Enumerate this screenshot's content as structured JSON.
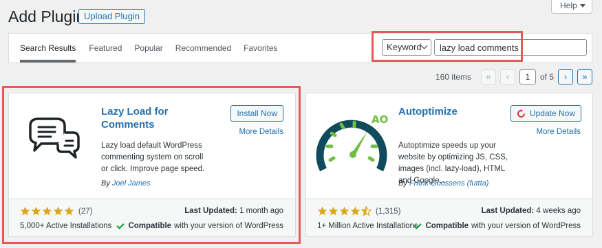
{
  "header": {
    "title": "Add Plugins",
    "upload_label": "Upload Plugin",
    "help_label": "Help"
  },
  "tabs": [
    {
      "label": "Search Results",
      "active": true
    },
    {
      "label": "Featured"
    },
    {
      "label": "Popular"
    },
    {
      "label": "Recommended"
    },
    {
      "label": "Favorites"
    }
  ],
  "search": {
    "type_selected": "Keyword",
    "query": "lazy load comments"
  },
  "pagination": {
    "items": "160 items",
    "first": "«",
    "prev": "‹",
    "current_page": "1",
    "total_pages": "of 5",
    "next": "›",
    "last": "»"
  },
  "plugins": [
    {
      "name": "Lazy Load for Comments",
      "action": "Install Now",
      "more": "More Details",
      "description": "Lazy load default WordPress commenting system on scroll or click. Improve page speed.",
      "by": "By",
      "author": "Joel James",
      "rating": 5,
      "rating_count": "(27)",
      "installs": "5,000+ Active Installations",
      "updated_label": "Last Updated:",
      "updated_value": "1 month ago",
      "compat_bold": "Compatible",
      "compat_rest": "with your version of WordPress",
      "icon": "speech-bubbles-icon"
    },
    {
      "name": "Autoptimize",
      "action": "Update Now",
      "more": "More Details",
      "description": "Autoptimize speeds up your website by optimizing JS, CSS, images (incl. lazy-load), HTML and Google…",
      "by": "By",
      "author": "Frank Goossens (futtta)",
      "rating": 4.5,
      "rating_count": "(1,315)",
      "installs": "1+ Million Active Installations",
      "updated_label": "Last Updated:",
      "updated_value": "4 weeks ago",
      "compat_bold": "Compatible",
      "compat_rest": "with your version of WordPress",
      "icon": "speedometer-icon",
      "icon_text": "AO"
    }
  ],
  "colors": {
    "link": "#2271b1",
    "star": "#dba617",
    "highlight": "#e45a57",
    "ao_green": "#6fbf44",
    "ao_dark": "#0f4b5c"
  }
}
